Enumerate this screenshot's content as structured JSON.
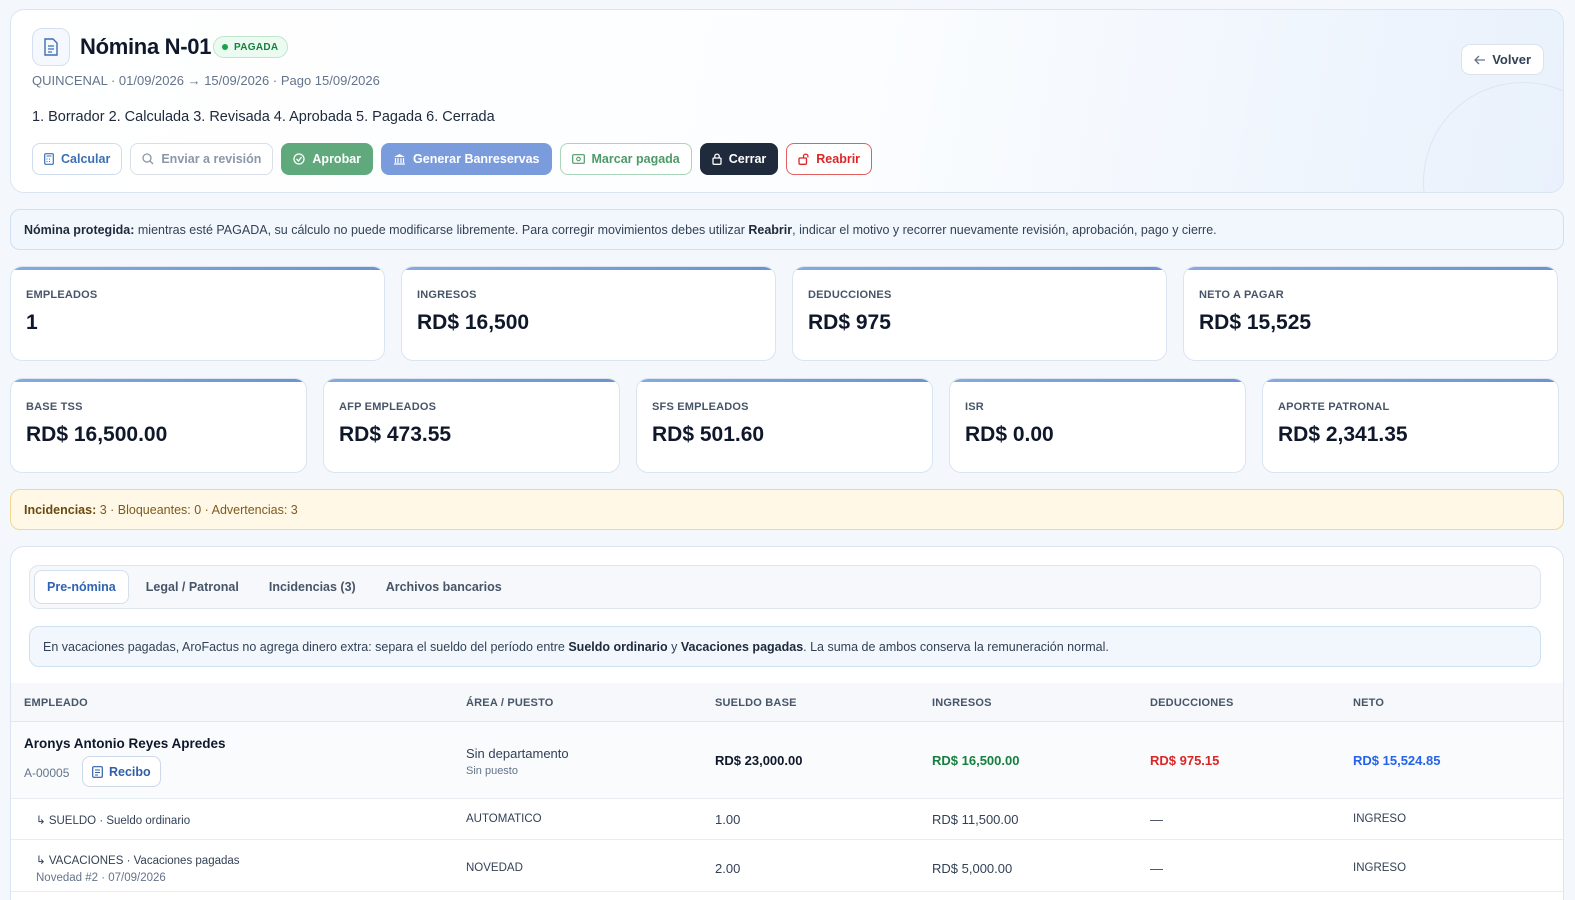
{
  "header": {
    "title": "Nómina N-01",
    "status": "PAGADA",
    "subtitle": "QUINCENAL · 01/09/2026 → 15/09/2026 · Pago 15/09/2026",
    "steps": "1. Borrador 2. Calculada 3. Revisada 4. Aprobada 5. Pagada 6. Cerrada",
    "back_label": "Volver",
    "actions": {
      "calcular": "Calcular",
      "revision": "Enviar a revisión",
      "aprobar": "Aprobar",
      "banreservas": "Generar Banreservas",
      "pagada": "Marcar pagada",
      "cerrar": "Cerrar",
      "reabrir": "Reabrir"
    }
  },
  "banner": {
    "lead": "Nómina protegida:",
    "text1": " mientras esté PAGADA, su cálculo no puede modificarse libremente. Para corregir movimientos debes utilizar ",
    "emph": "Reabrir",
    "text2": ", indicar el motivo y recorrer nuevamente revisión, aprobación, pago y cierre."
  },
  "stats_row1": [
    {
      "label": "EMPLEADOS",
      "value": "1"
    },
    {
      "label": "INGRESOS",
      "value": "RD$ 16,500"
    },
    {
      "label": "DEDUCCIONES",
      "value": "RD$ 975"
    },
    {
      "label": "NETO A PAGAR",
      "value": "RD$ 15,525"
    }
  ],
  "stats_row2": [
    {
      "label": "BASE TSS",
      "value": "RD$ 16,500.00"
    },
    {
      "label": "AFP EMPLEADOS",
      "value": "RD$ 473.55"
    },
    {
      "label": "SFS EMPLEADOS",
      "value": "RD$ 501.60"
    },
    {
      "label": "ISR",
      "value": "RD$ 0.00"
    },
    {
      "label": "APORTE PATRONAL",
      "value": "RD$ 2,341.35"
    }
  ],
  "incidencias": {
    "lead": "Incidencias:",
    "text": " 3 · Bloqueantes: 0 · Advertencias: 3"
  },
  "tabs": [
    "Pre-nómina",
    "Legal / Patronal",
    "Incidencias (3)",
    "Archivos bancarios"
  ],
  "note": {
    "text1": "En vacaciones pagadas, AroFactus no agrega dinero extra: separa el sueldo del período entre ",
    "emph1": "Sueldo ordinario",
    "text2": " y ",
    "emph2": "Vacaciones pagadas",
    "text3": ". La suma de ambos conserva la remuneración normal."
  },
  "table": {
    "headers": [
      "EMPLEADO",
      "ÁREA / PUESTO",
      "SUELDO BASE",
      "INGRESOS",
      "DEDUCCIONES",
      "NETO"
    ],
    "employee": {
      "name": "Aronys Antonio Reyes Apredes",
      "code": "A-00005",
      "receipt_label": "Recibo",
      "department": "Sin departamento",
      "position": "Sin puesto",
      "base_salary": "RD$ 23,000.00",
      "income": "RD$ 16,500.00",
      "deductions": "RD$ 975.15",
      "net": "RD$ 15,524.85"
    },
    "lines": [
      {
        "concept": "↳ SUELDO · Sueldo ordinario",
        "detail": "",
        "origin": "AUTOMATICO",
        "qty": "1.00",
        "amount": "RD$ 11,500.00",
        "deduction": "—",
        "type": "INGRESO"
      },
      {
        "concept": "↳ VACACIONES · Vacaciones pagadas",
        "detail": "Novedad #2 · 07/09/2026",
        "origin": "NOVEDAD",
        "qty": "2.00",
        "amount": "RD$ 5,000.00",
        "deduction": "—",
        "type": "INGRESO"
      }
    ]
  }
}
